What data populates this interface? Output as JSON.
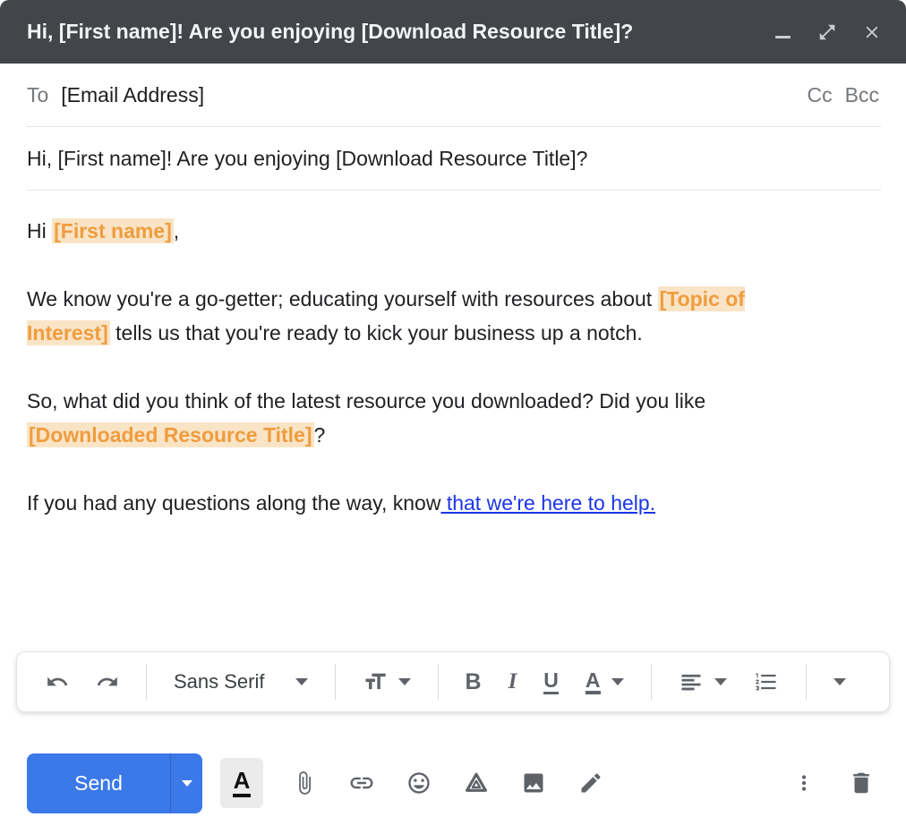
{
  "colors": {
    "titlebar_bg": "#424549",
    "accent_blue": "#3b78e8",
    "link_blue": "#1c35e8",
    "merge_text": "#ef9c3e",
    "merge_highlight": "#f9e4c6",
    "icon_gray": "#5f6368",
    "text_dark": "#202124",
    "muted_gray": "#75787c"
  },
  "window": {
    "title": "Hi, [First name]! Are you enjoying [Download Resource Title]?",
    "controls": [
      {
        "name": "minimize-icon"
      },
      {
        "name": "expand-icon"
      },
      {
        "name": "close-icon"
      }
    ]
  },
  "recipients": {
    "to_label": "To",
    "to_value": "[Email Address]",
    "cc_label": "Cc",
    "bcc_label": "Bcc"
  },
  "subject": "Hi, [First name]! Are you enjoying [Download Resource Title]?",
  "body": {
    "paragraphs": [
      {
        "segments": [
          {
            "text": "Hi ",
            "style": "normal"
          },
          {
            "text": "[First name]",
            "style": "merge"
          },
          {
            "text": ",",
            "style": "normal"
          }
        ]
      },
      {
        "segments": [
          {
            "text": "We know you're a go-getter; educating yourself with resources about ",
            "style": "normal"
          },
          {
            "text": "[Topic of Interest]",
            "style": "merge"
          },
          {
            "text": " tells us that you're ready to kick your business up a notch.",
            "style": "normal"
          }
        ]
      },
      {
        "segments": [
          {
            "text": "So, what did you think of the latest resource you downloaded? Did you like ",
            "style": "normal"
          },
          {
            "text": "[Downloaded Resource Title]",
            "style": "merge"
          },
          {
            "text": "?",
            "style": "normal"
          }
        ]
      },
      {
        "segments": [
          {
            "text": "If you had any questions along the way, know",
            "style": "normal"
          },
          {
            "text": " that we're here to help.",
            "style": "link"
          }
        ]
      }
    ]
  },
  "format_toolbar": {
    "undo_icon": "undo-icon",
    "redo_icon": "redo-icon",
    "font_label": "Sans Serif",
    "size_icon": "font-size-icon",
    "bold_label": "B",
    "italic_label": "I",
    "underline_label": "U",
    "color_label": "A",
    "align_icon": "align-left-icon",
    "list_icon": "numbered-list-icon",
    "more_icon": "more-formatting-icon"
  },
  "action_bar": {
    "send_label": "Send",
    "formatting_label": "A",
    "icons": [
      "attach-icon",
      "insert-link-icon",
      "emoji-icon",
      "drive-icon",
      "insert-photo-icon",
      "pen-icon",
      "more-options-icon",
      "trash-icon"
    ]
  }
}
